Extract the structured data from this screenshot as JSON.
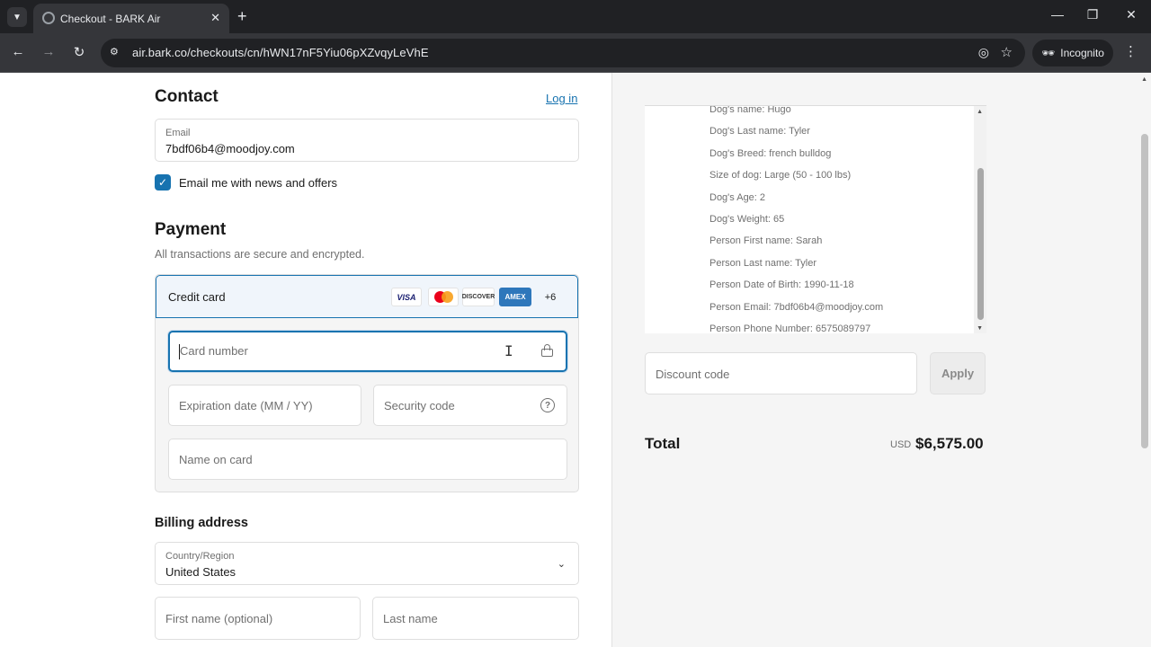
{
  "browser": {
    "tab_title": "Checkout - BARK Air",
    "tab_close": "✕",
    "new_tab": "+",
    "url": "air.bark.co/checkouts/cn/hWN17nF5Yiu06pXZvqyLeVhE",
    "incognito_label": "Incognito",
    "icons": [
      "tab-list-icon",
      "favicon-icon",
      "close-icon",
      "plus-icon",
      "minimize-icon",
      "restore-icon",
      "close-window-icon",
      "back-icon",
      "forward-icon",
      "reload-icon",
      "site-info-icon",
      "eye-off-icon",
      "star-icon",
      "incognito-icon",
      "more-vert-icon"
    ]
  },
  "contact": {
    "title": "Contact",
    "login_link": "Log in",
    "email_label": "Email",
    "email_value": "7bdf06b4@moodjoy.com",
    "newsletter_label": "Email me with news and offers",
    "newsletter_checked": true
  },
  "payment": {
    "title": "Payment",
    "subtitle": "All transactions are secure and encrypted.",
    "method_label": "Credit card",
    "brands": {
      "visa": "VISA",
      "discover": "DISCOVER",
      "amex": "AMEX",
      "more": "+6"
    },
    "card_number_placeholder": "Card number",
    "expiration_placeholder": "Expiration date (MM / YY)",
    "security_placeholder": "Security code",
    "name_placeholder": "Name on card",
    "help_glyph": "?"
  },
  "billing": {
    "title": "Billing address",
    "country_label": "Country/Region",
    "country_value": "United States",
    "first_name_placeholder": "First name (optional)",
    "last_name_placeholder": "Last name"
  },
  "summary": {
    "details": [
      "Dog's name: Hugo",
      "Dog's Last name: Tyler",
      "Dog's Breed: french bulldog",
      "Size of dog: Large (50 - 100 lbs)",
      "Dog's Age: 2",
      "Dog's Weight: 65",
      "Person First name: Sarah",
      "Person Last name: Tyler",
      "Person Date of Birth: 1990-11-18",
      "Person Email: 7bdf06b4@moodjoy.com",
      "Person Phone Number: 6575089797"
    ],
    "discount_placeholder": "Discount code",
    "apply_label": "Apply",
    "total_label": "Total",
    "currency": "USD",
    "total_amount": "$6,575.00"
  },
  "colors": {
    "accent": "#1773b0",
    "amex": "#2e77bb",
    "mc_red": "#eb001b",
    "mc_orange": "#f79e1b"
  }
}
